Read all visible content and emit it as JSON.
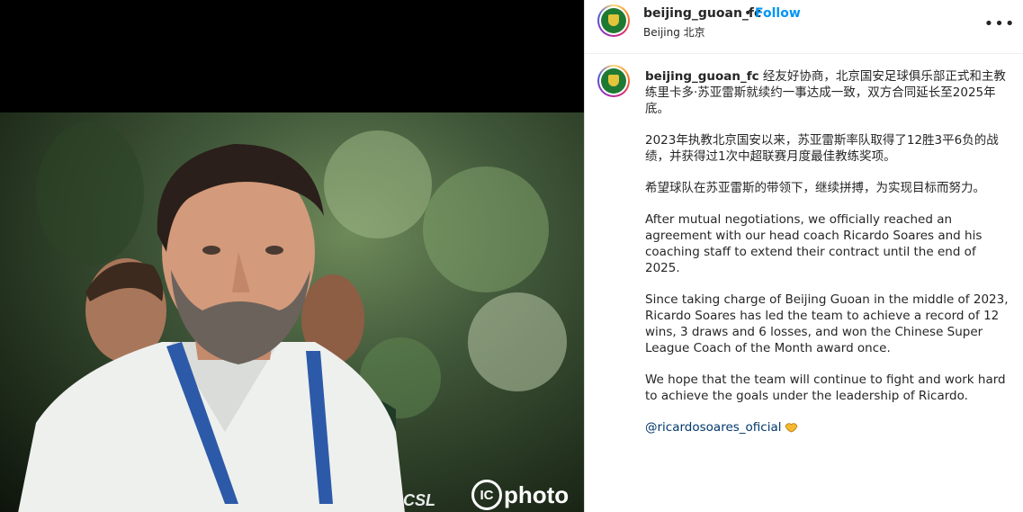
{
  "post": {
    "username": "beijing_guoan_fc",
    "follow_label": "Follow",
    "separator": "•",
    "location": "Beijing 北京",
    "more_label": "•••"
  },
  "media": {
    "watermark_csl": "CSL",
    "watermark_ic": "IC",
    "watermark_photo": "photo"
  },
  "caption": {
    "username": "beijing_guoan_fc",
    "para1": "经友好协商，北京国安足球俱乐部正式和主教练里卡多·苏亚雷斯就续约一事达成一致，双方合同延长至2025年底。",
    "para2": "2023年执教北京国安以来，苏亚雷斯率队取得了12胜3平6负的战绩，并获得过1次中超联赛月度最佳教练奖项。",
    "para3": "希望球队在苏亚雷斯的带领下，继续拼搏，为实现目标而努力。",
    "para4": "After mutual negotiations, we officially reached an agreement with our head coach Ricardo Soares and his coaching staff to extend their contract until the end of 2025.",
    "para5": "Since taking charge of Beijing Guoan in the middle of 2023, Ricardo Soares has led the team to achieve a record of 12 wins, 3 draws and 6 losses, and won the Chinese Super League Coach of the Month award once.",
    "para6": "We hope that the team will continue to fight and work hard to achieve the goals under the leadership of Ricardo.",
    "mention": "@ricardosoares_oficial"
  },
  "colors": {
    "link": "#0095f6",
    "mention": "#00376b",
    "crest": "#1e7a33"
  }
}
